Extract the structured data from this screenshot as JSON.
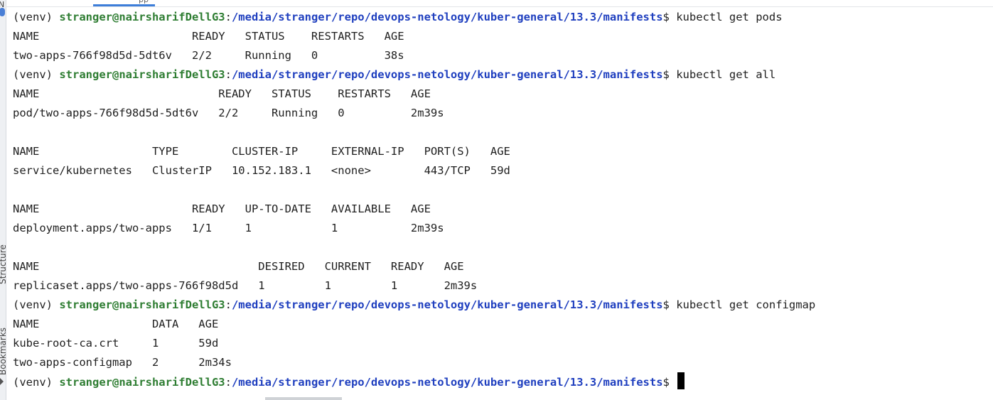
{
  "sidebar": {
    "structure_label": "Structure",
    "bookmarks_label": "Bookmarks"
  },
  "prompt": {
    "venv": "(venv) ",
    "user_host": "stranger@nairsharifDellG3",
    "colon": ":",
    "path": "/media/stranger/repo/devops-netology/kuber-general/13.3/manifests",
    "symbol": "$ "
  },
  "session": [
    {
      "type": "prompt",
      "command": "kubectl get pods"
    },
    {
      "type": "output",
      "text": "NAME                       READY   STATUS    RESTARTS   AGE"
    },
    {
      "type": "output",
      "text": "two-apps-766f98d5d-5dt6v   2/2     Running   0          38s"
    },
    {
      "type": "prompt",
      "command": "kubectl get all"
    },
    {
      "type": "output",
      "text": "NAME                           READY   STATUS    RESTARTS   AGE"
    },
    {
      "type": "output",
      "text": "pod/two-apps-766f98d5d-5dt6v   2/2     Running   0          2m39s"
    },
    {
      "type": "output",
      "text": ""
    },
    {
      "type": "output",
      "text": "NAME                 TYPE        CLUSTER-IP     EXTERNAL-IP   PORT(S)   AGE"
    },
    {
      "type": "output",
      "text": "service/kubernetes   ClusterIP   10.152.183.1   <none>        443/TCP   59d"
    },
    {
      "type": "output",
      "text": ""
    },
    {
      "type": "output",
      "text": "NAME                       READY   UP-TO-DATE   AVAILABLE   AGE"
    },
    {
      "type": "output",
      "text": "deployment.apps/two-apps   1/1     1            1           2m39s"
    },
    {
      "type": "output",
      "text": ""
    },
    {
      "type": "output",
      "text": "NAME                                 DESIRED   CURRENT   READY   AGE"
    },
    {
      "type": "output",
      "text": "replicaset.apps/two-apps-766f98d5d   1         1         1       2m39s"
    },
    {
      "type": "prompt",
      "command": "kubectl get configmap"
    },
    {
      "type": "output",
      "text": "NAME                 DATA   AGE"
    },
    {
      "type": "output",
      "text": "kube-root-ca.crt     1      59d"
    },
    {
      "type": "output",
      "text": "two-apps-configmap   2      2m34s"
    },
    {
      "type": "prompt",
      "command": ""
    }
  ],
  "colors": {
    "user_host": "#2e7d32",
    "path": "#1f3fbf",
    "text": "#1f1f1f",
    "accent": "#3d7ed9"
  }
}
